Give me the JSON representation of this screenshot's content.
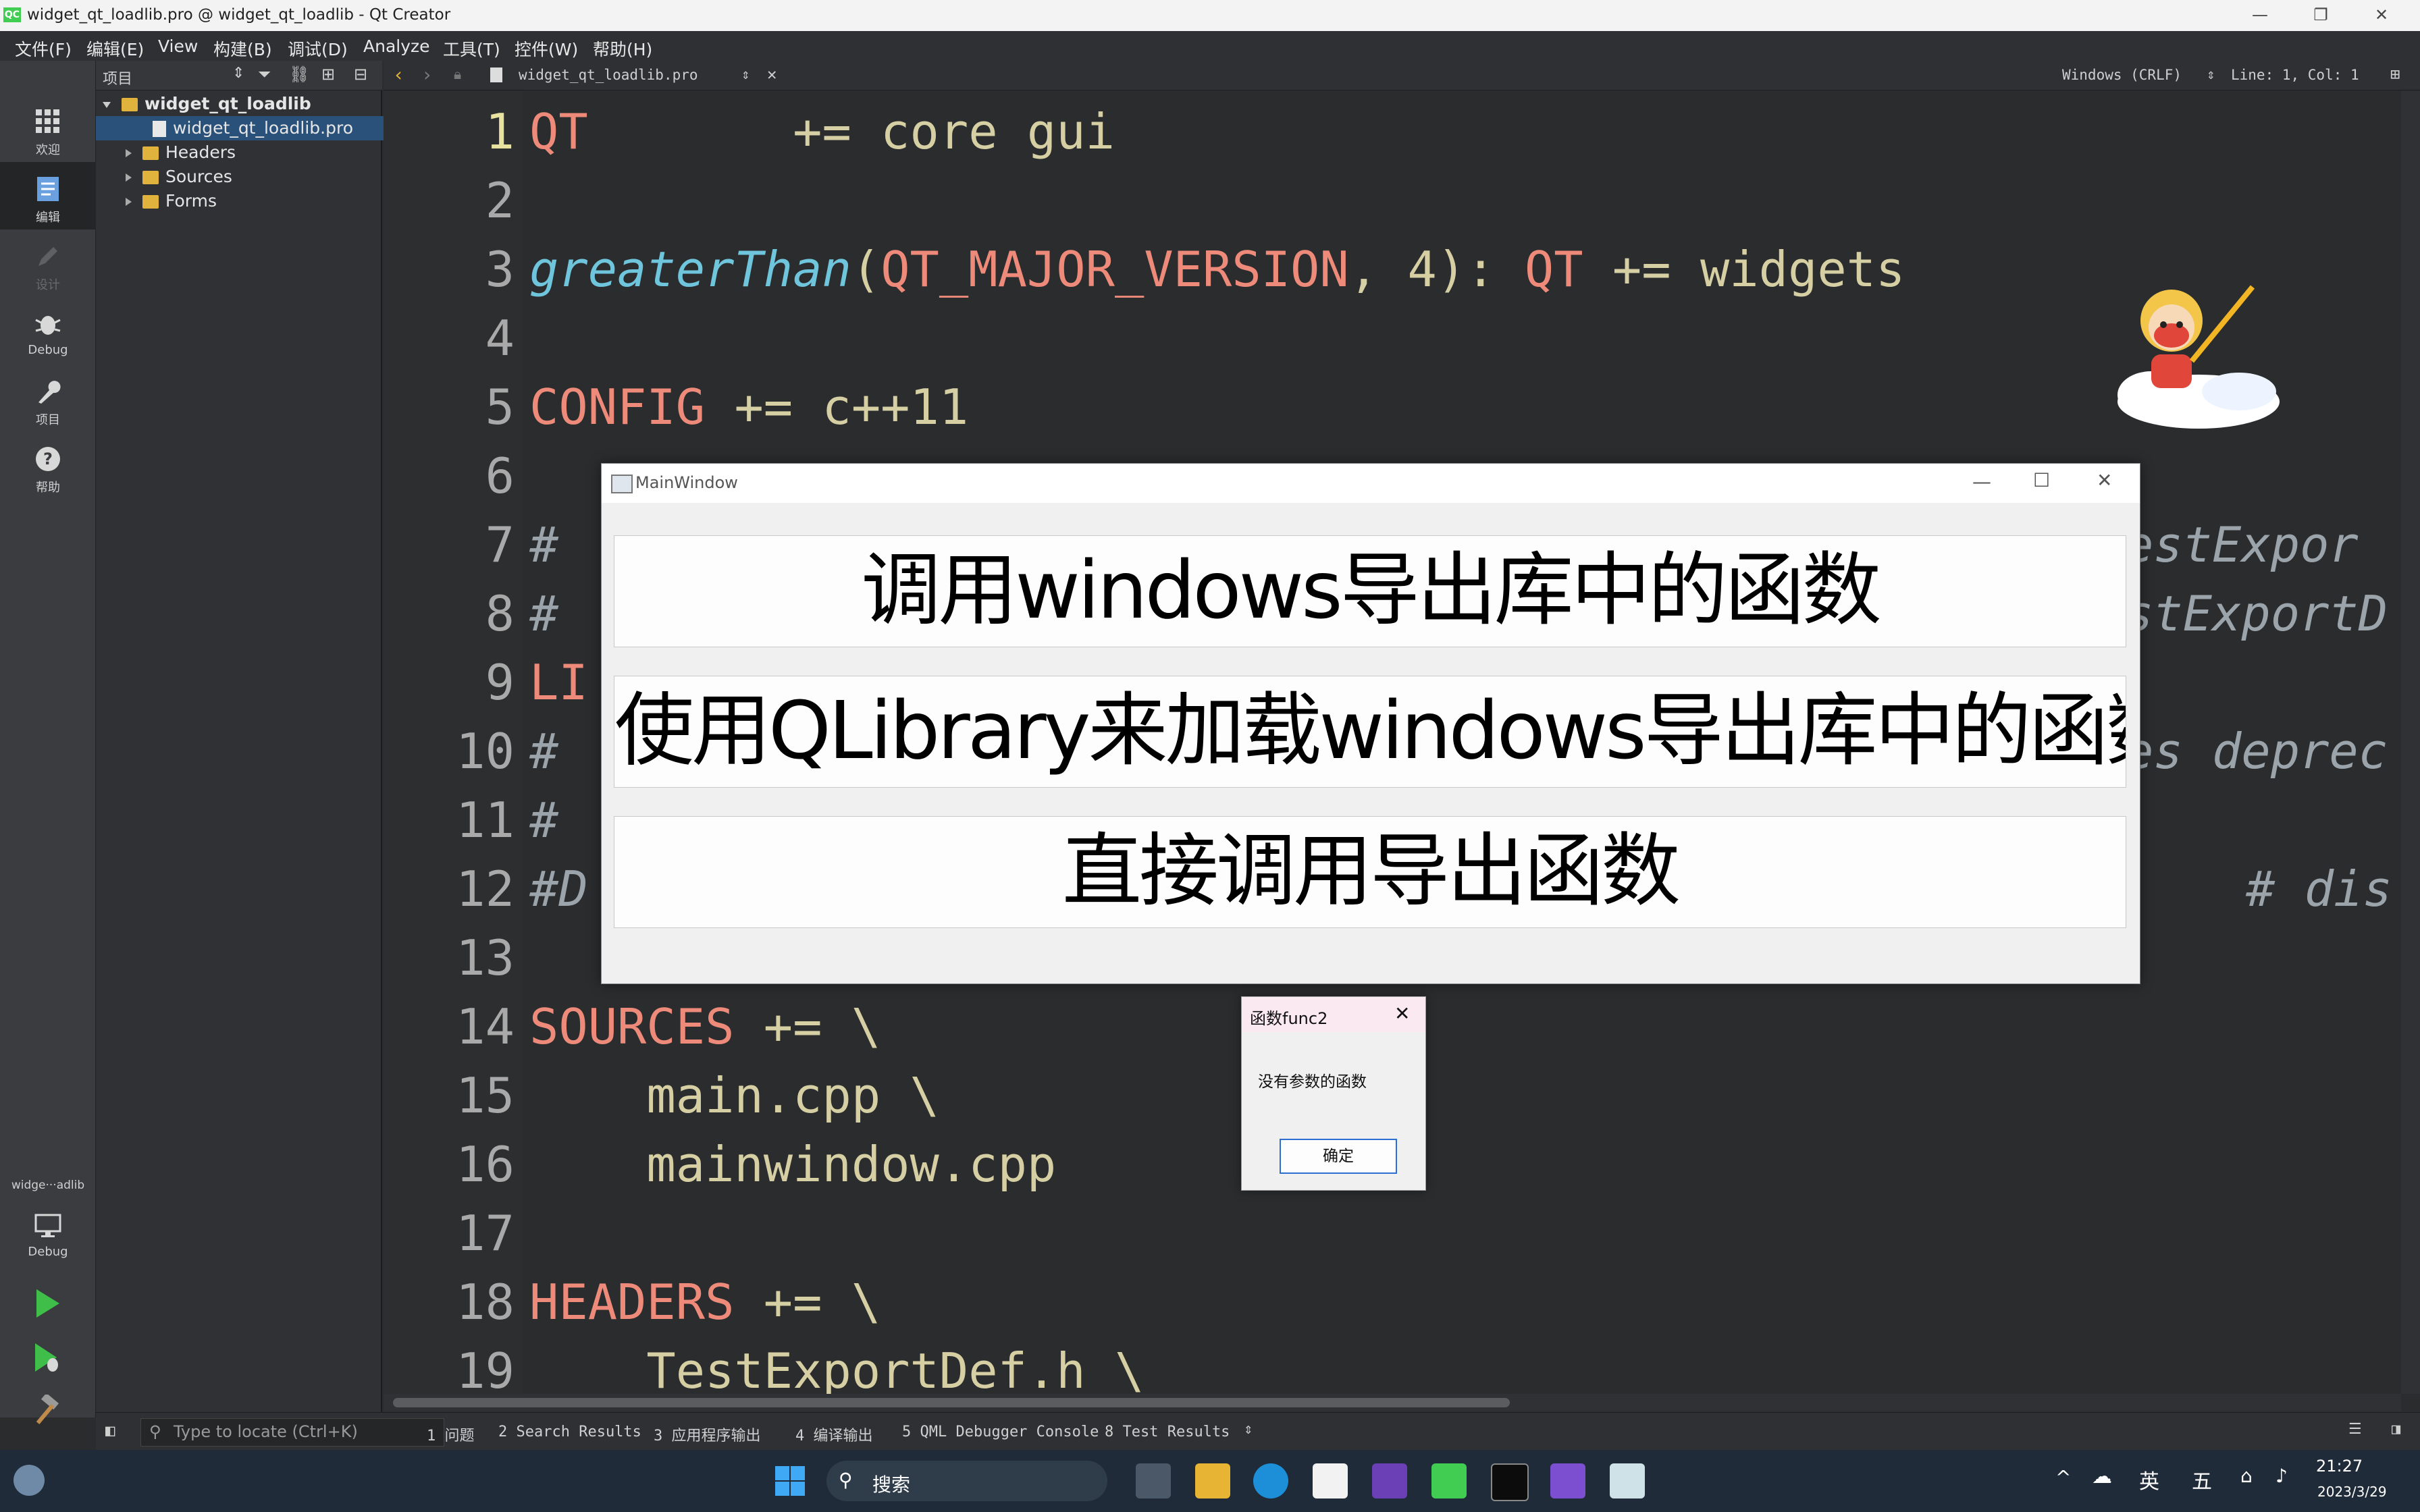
{
  "window": {
    "title": "widget_qt_loadlib.pro @ widget_qt_loadlib - Qt Creator",
    "logo": "QC",
    "minimize": "—",
    "maximize": "❐",
    "close": "✕"
  },
  "menubar": {
    "items": [
      "文件(F)",
      "编辑(E)",
      "View",
      "构建(B)",
      "调试(D)",
      "Analyze",
      "工具(T)",
      "控件(W)",
      "帮助(H)"
    ]
  },
  "modes": {
    "welcome": "欢迎",
    "edit": "编辑",
    "design": "设计",
    "debug": "Debug",
    "projects": "项目",
    "help": "帮助",
    "kit_name": "widge···adlib",
    "kit_mode": "Debug"
  },
  "project_panel": {
    "selector": "项目",
    "tree": {
      "root": "widget_qt_loadlib",
      "file": "widget_qt_loadlib.pro",
      "headers": "Headers",
      "sources": "Sources",
      "forms": "Forms"
    }
  },
  "editor": {
    "file_tab": "widget_qt_loadlib.pro",
    "line_endings": "Windows (CRLF)",
    "cursor_pos": "Line: 1, Col: 1",
    "line_numbers": [
      "1",
      "2",
      "3",
      "4",
      "5",
      "6",
      "7",
      "8",
      "9",
      "10",
      "11",
      "12",
      "13",
      "14",
      "15",
      "16",
      "17",
      "18",
      "19"
    ],
    "code": {
      "l1_kw": "QT",
      "l1_rest": "       += core gui",
      "l3_fn": "greaterThan",
      "l3_a": "(",
      "l3_kw1": "QT_MAJOR_VERSION",
      "l3_b": ", 4): ",
      "l3_kw2": "QT",
      "l3_c": " += widgets",
      "l5_kw": "CONFIG",
      "l5_rest": " += c++11",
      "l7_left": "# ",
      "l7_right": "estExpor",
      "l8_left": "# ",
      "l8_right": "stExportD",
      "l9_left": "LI",
      "l10_left": "# ",
      "l10_right": "es deprec",
      "l11_left": "# ",
      "l12_left": "#D",
      "l12_right": "# dis",
      "l14_kw": "SOURCES",
      "l14_rest": " += \\",
      "l15": "    main.cpp \\",
      "l16": "    mainwindow.cpp",
      "l18_kw": "HEADERS",
      "l18_rest": " += \\",
      "l19": "    TestExportDef.h \\"
    }
  },
  "output_bar": {
    "locate_placeholder": "Type to locate (Ctrl+K)",
    "tabs": [
      "1  问题",
      "2  Search Results",
      "3  应用程序输出",
      "4  编译输出",
      "5  QML Debugger Console",
      "8  Test Results"
    ]
  },
  "main_window": {
    "title": "MainWindow",
    "buttons": [
      "调用windows导出库中的函数",
      "使用QLibrary来加载windows导出库中的函数",
      "直接调用导出函数"
    ]
  },
  "message_box": {
    "title": "函数func2",
    "text": "没有参数的函数",
    "ok": "确定"
  },
  "taskbar": {
    "search": "搜索",
    "ime": "英",
    "weekday": "五",
    "time": "21:27",
    "date": "2023/3/29"
  },
  "colors": {
    "keyword": "#ee8a7a",
    "function": "#6fc6dc",
    "text": "#d6cfa4",
    "selection": "#2a5179",
    "accent_blue": "#2b6fd0"
  }
}
